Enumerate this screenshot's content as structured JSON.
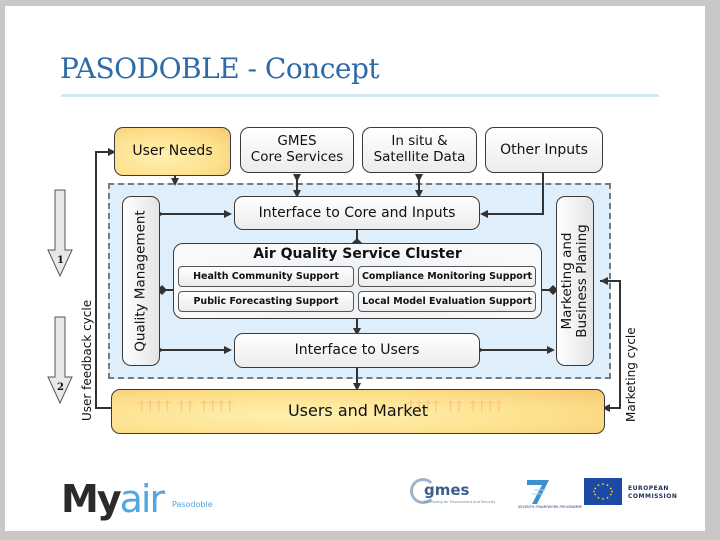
{
  "slide": {
    "title": "PASODOBLE - Concept"
  },
  "inputs": {
    "user_needs": "User Needs",
    "gmes_line1": "GMES",
    "gmes_line2": "Core Services",
    "insitu_line1": "In situ &",
    "insitu_line2": "Satellite Data",
    "other_inputs": "Other Inputs"
  },
  "core": {
    "interface_core": "Interface to Core and Inputs",
    "cluster_title": "Air Quality Service Cluster",
    "services": [
      "Health Community Support",
      "Compliance Monitoring Support",
      "Public Forecasting Support",
      "Local Model Evaluation Support"
    ],
    "interface_users": "Interface to Users",
    "quality_management": "Quality Management",
    "marketing_line1": "Marketing and",
    "marketing_line2": "Business Planing"
  },
  "users": {
    "label": "Users and Market",
    "people_left": "†††† †† ††††",
    "people_right": "†††† †† ††††"
  },
  "cycles": {
    "user_feedback": "User feedback cycle",
    "marketing": "Marketing cycle",
    "step1": "1",
    "step2": "2"
  },
  "logos": {
    "myair_my": "My",
    "myair_air": "air",
    "myair_sub": "Pasodoble",
    "gmes": "GMES",
    "gmes_tag": "Monitoring for Environment and Security",
    "fp7": "7",
    "fp7_sub": "SEVENTH FRAMEWORK PROGRAMME",
    "eu_line1": "EUROPEAN",
    "eu_line2": "COMMISSION"
  },
  "colors": {
    "title": "#2e6aa5",
    "title_rule": "#d6e8f4",
    "core_region": "#dfeefb",
    "gold_box": "#fde08c",
    "line": "#333333"
  }
}
